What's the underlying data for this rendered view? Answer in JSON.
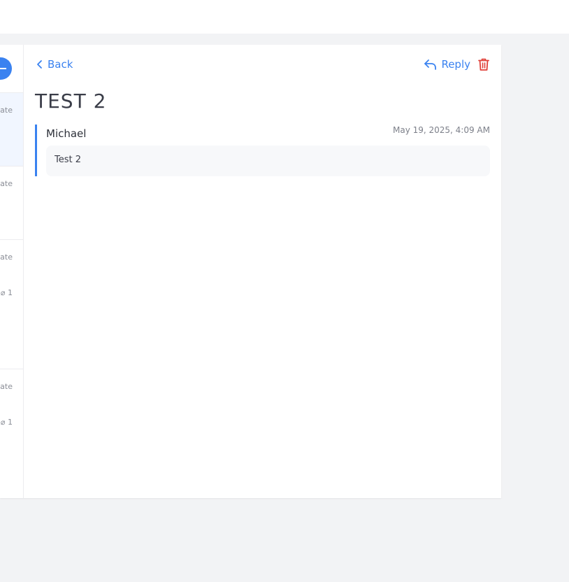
{
  "list": {
    "items": [
      {
        "meta": "ate",
        "attach": ""
      },
      {
        "meta": "ate",
        "attach": ""
      },
      {
        "meta": "ate",
        "attach": "1"
      },
      {
        "meta": "ate",
        "attach": "1"
      }
    ]
  },
  "detail": {
    "back_label": "Back",
    "reply_label": "Reply",
    "subject": "TEST 2",
    "message": {
      "sender": "Michael",
      "timestamp": "May 19, 2025, 4:09 AM",
      "body": "Test 2"
    }
  },
  "colors": {
    "accent": "#3a82f0",
    "danger": "#e0413a",
    "background": "#f2f3f5"
  }
}
